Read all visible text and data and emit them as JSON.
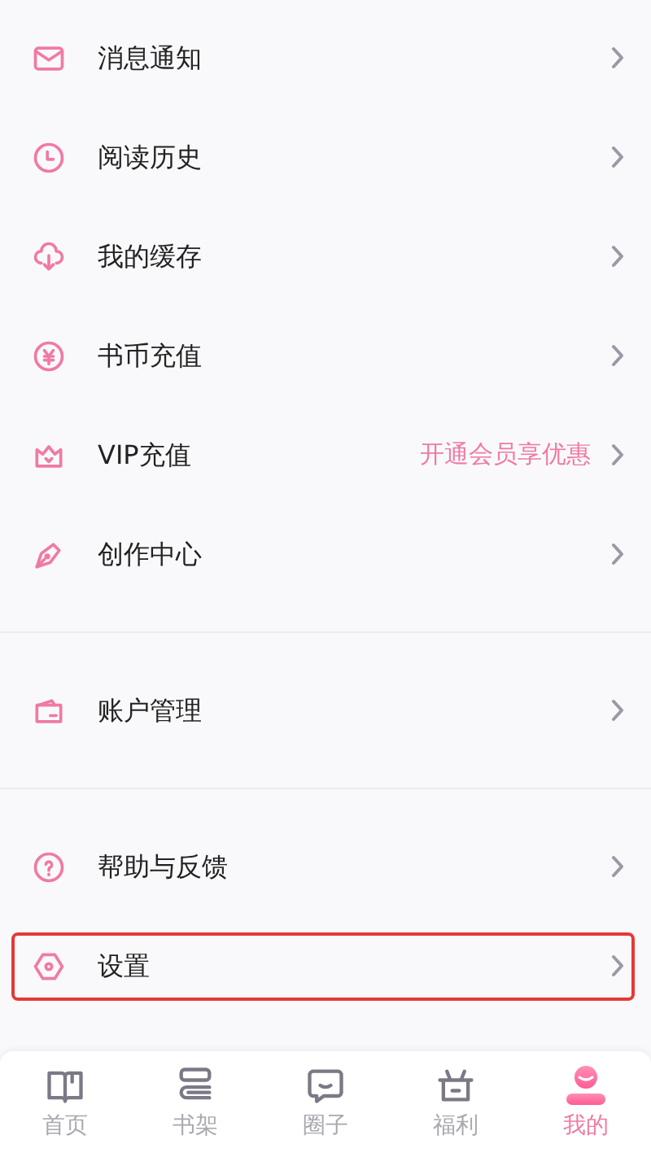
{
  "sections": [
    {
      "items": [
        {
          "kind": "mail",
          "label": "消息通知",
          "highlighted": false
        },
        {
          "kind": "clock",
          "label": "阅读历史",
          "highlighted": false
        },
        {
          "kind": "cloud",
          "label": "我的缓存",
          "highlighted": false
        },
        {
          "kind": "coin",
          "label": "书币充值",
          "highlighted": false
        },
        {
          "kind": "crown",
          "label": "VIP充值",
          "hint": "开通会员享优惠",
          "highlighted": false
        },
        {
          "kind": "pen",
          "label": "创作中心",
          "highlighted": false
        }
      ]
    },
    {
      "items": [
        {
          "kind": "wallet",
          "label": "账户管理",
          "highlighted": false
        }
      ]
    },
    {
      "items": [
        {
          "kind": "help",
          "label": "帮助与反馈",
          "highlighted": false
        },
        {
          "kind": "gear",
          "label": "设置",
          "highlighted": true
        }
      ]
    }
  ],
  "tab_bar": [
    {
      "kind": "book",
      "label": "首页",
      "selected": false
    },
    {
      "kind": "shelf",
      "label": "书架",
      "selected": false
    },
    {
      "kind": "chat",
      "label": "圈子",
      "selected": false
    },
    {
      "kind": "gift",
      "label": "福利",
      "selected": false
    },
    {
      "kind": "user",
      "label": "我的",
      "selected": true
    }
  ]
}
